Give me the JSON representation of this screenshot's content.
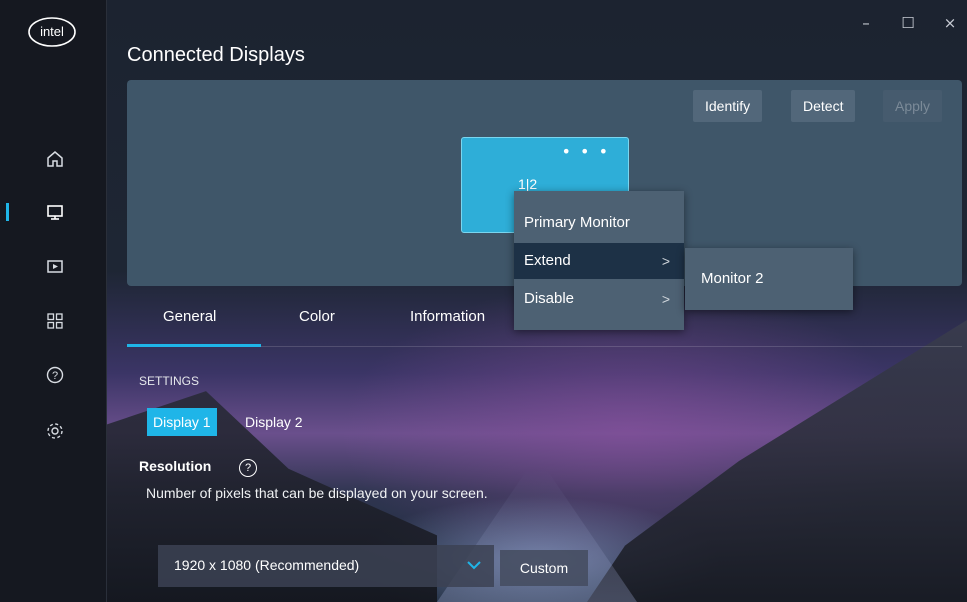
{
  "brand": {
    "logo_text": "intel"
  },
  "window": {
    "minimize": "–",
    "maximize": "☐",
    "close": "×"
  },
  "sidebar": {
    "items": [
      {
        "name": "home"
      },
      {
        "name": "display",
        "active": true
      },
      {
        "name": "video"
      },
      {
        "name": "apps"
      },
      {
        "name": "help"
      },
      {
        "name": "settings"
      }
    ]
  },
  "page": {
    "title": "Connected Displays"
  },
  "display_area": {
    "buttons": {
      "identify": "Identify",
      "detect": "Detect",
      "apply": "Apply"
    },
    "monitor": {
      "label": "1|2",
      "more": "• • •"
    }
  },
  "context_menu": {
    "items": [
      {
        "label": "Primary Monitor",
        "arrow": ""
      },
      {
        "label": "Extend",
        "arrow": ">"
      },
      {
        "label": "Disable",
        "arrow": ">"
      }
    ],
    "submenu": {
      "label": "Monitor 2"
    }
  },
  "tabs": [
    "General",
    "Color",
    "Information"
  ],
  "settings": {
    "section_label": "SETTINGS",
    "display_tabs": [
      "Display 1",
      "Display 2"
    ],
    "resolution": {
      "title": "Resolution",
      "help": "?",
      "description": "Number of pixels that can be displayed on your screen.",
      "value": "1920 x 1080 (Recommended)",
      "custom_label": "Custom"
    }
  },
  "colors": {
    "accent": "#1fb5e8",
    "panel": "#3f5669",
    "menu": "#4d6173"
  }
}
